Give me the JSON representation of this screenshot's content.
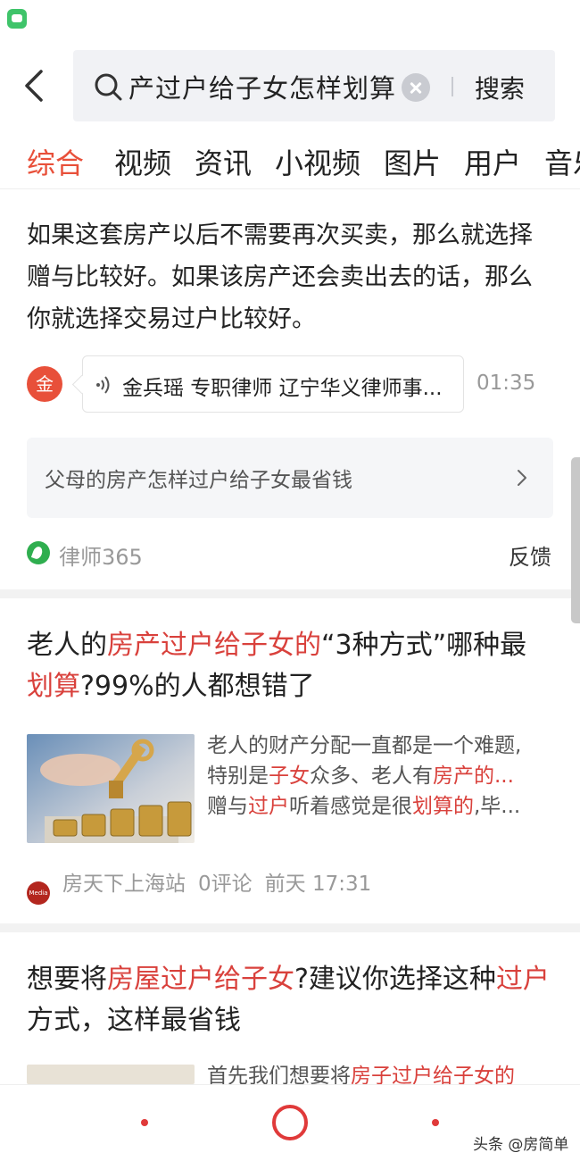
{
  "search": {
    "query": "产过户给子女怎样划算",
    "button_label": "搜索"
  },
  "tabs": [
    "综合",
    "视频",
    "资讯",
    "小视频",
    "图片",
    "用户",
    "音乐"
  ],
  "answer_card": {
    "text": "如果这套房产以后不需要再次买卖，那么就选择赠与比较好。如果该房产还会卖出去的话，那么你就选择交易过户比较好。",
    "avatar_char": "金",
    "lawyer": "金兵瑶 专职律师 辽宁华义律师事...",
    "duration": "01:35",
    "related_question": "父母的房产怎样过户给子女最省钱",
    "source": "律师365",
    "feedback": "反馈"
  },
  "article1": {
    "title_parts": [
      "老人的",
      "房产过户给子女的",
      "“3种方式”哪种最",
      "划算",
      "?99%的人都想错了"
    ],
    "snippet_line1": "老人的财产分配一直都是一个难题,",
    "snippet_line2_parts": [
      "特别是",
      "子女",
      "众多、老人有",
      "房产的..."
    ],
    "snippet_line3_parts": [
      "赠与",
      "过户",
      "听着感觉是很",
      "划算的",
      ",毕..."
    ],
    "source": "房天下上海站",
    "comments": "0评论",
    "time": "前天 17:31"
  },
  "article2": {
    "title_parts": [
      "想要将",
      "房屋过户给子女",
      "?建议你选择这种",
      "过户",
      "方式，这样最省钱"
    ],
    "snippet_parts": [
      "首先我们想要将",
      "房子过户给子女的"
    ]
  },
  "footer": {
    "watermark": "头条 @房简单"
  },
  "colors": {
    "accent": "#e8503a",
    "highlight": "#d9413c"
  }
}
